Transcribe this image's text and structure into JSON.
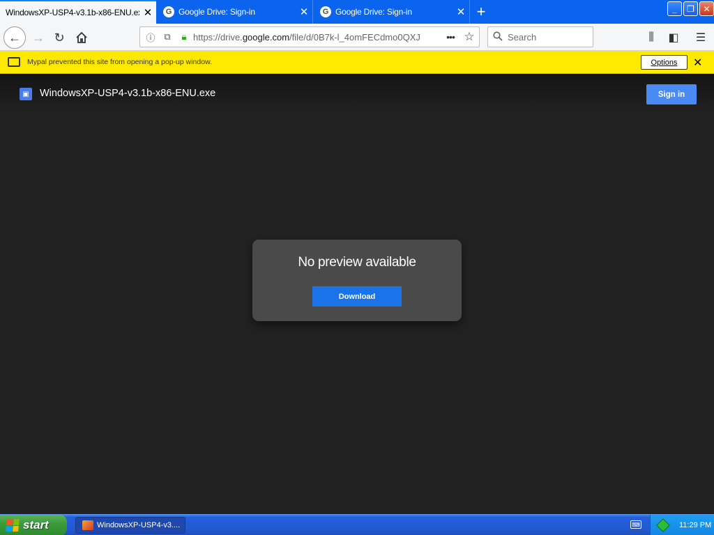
{
  "browser": {
    "tabs": [
      {
        "title": "WindowsXP-USP4-v3.1b-x86-ENU.exe",
        "active": true,
        "favicon": "none"
      },
      {
        "title": "Google Drive: Sign-in",
        "active": false,
        "favicon": "google-icon"
      },
      {
        "title": "Google Drive: Sign-in",
        "active": false,
        "favicon": "google-icon"
      }
    ],
    "new_tab_label": "+",
    "url": {
      "prefix": "https://drive.",
      "domain": "google.com",
      "path": "/file/d/0B7k-l_4omFECdmo0QXJ"
    },
    "search_placeholder": "Search",
    "window_controls": {
      "minimize": "_",
      "restore": "❐",
      "close": "✕"
    }
  },
  "notification": {
    "message": "Mypal prevented this site from opening a pop-up window.",
    "options_label": "Options",
    "close_label": "✕"
  },
  "page": {
    "filename": "WindowsXP-USP4-v3.1b-x86-ENU.exe",
    "sign_in_label": "Sign in",
    "preview_title": "No preview available",
    "download_label": "Download"
  },
  "taskbar": {
    "start_label": "start",
    "task_title": "WindowsXP-USP4-v3....",
    "clock": "11:29 PM"
  },
  "colors": {
    "tab_strip": "#0a64ee",
    "notification_bar": "#ffe900",
    "page_background": "#222223",
    "sign_in_button": "#4a8af4",
    "download_button": "#1a73e8",
    "preview_card": "#4b4a4b",
    "taskbar": "#245edb",
    "start_button": "#3c9c3c"
  }
}
